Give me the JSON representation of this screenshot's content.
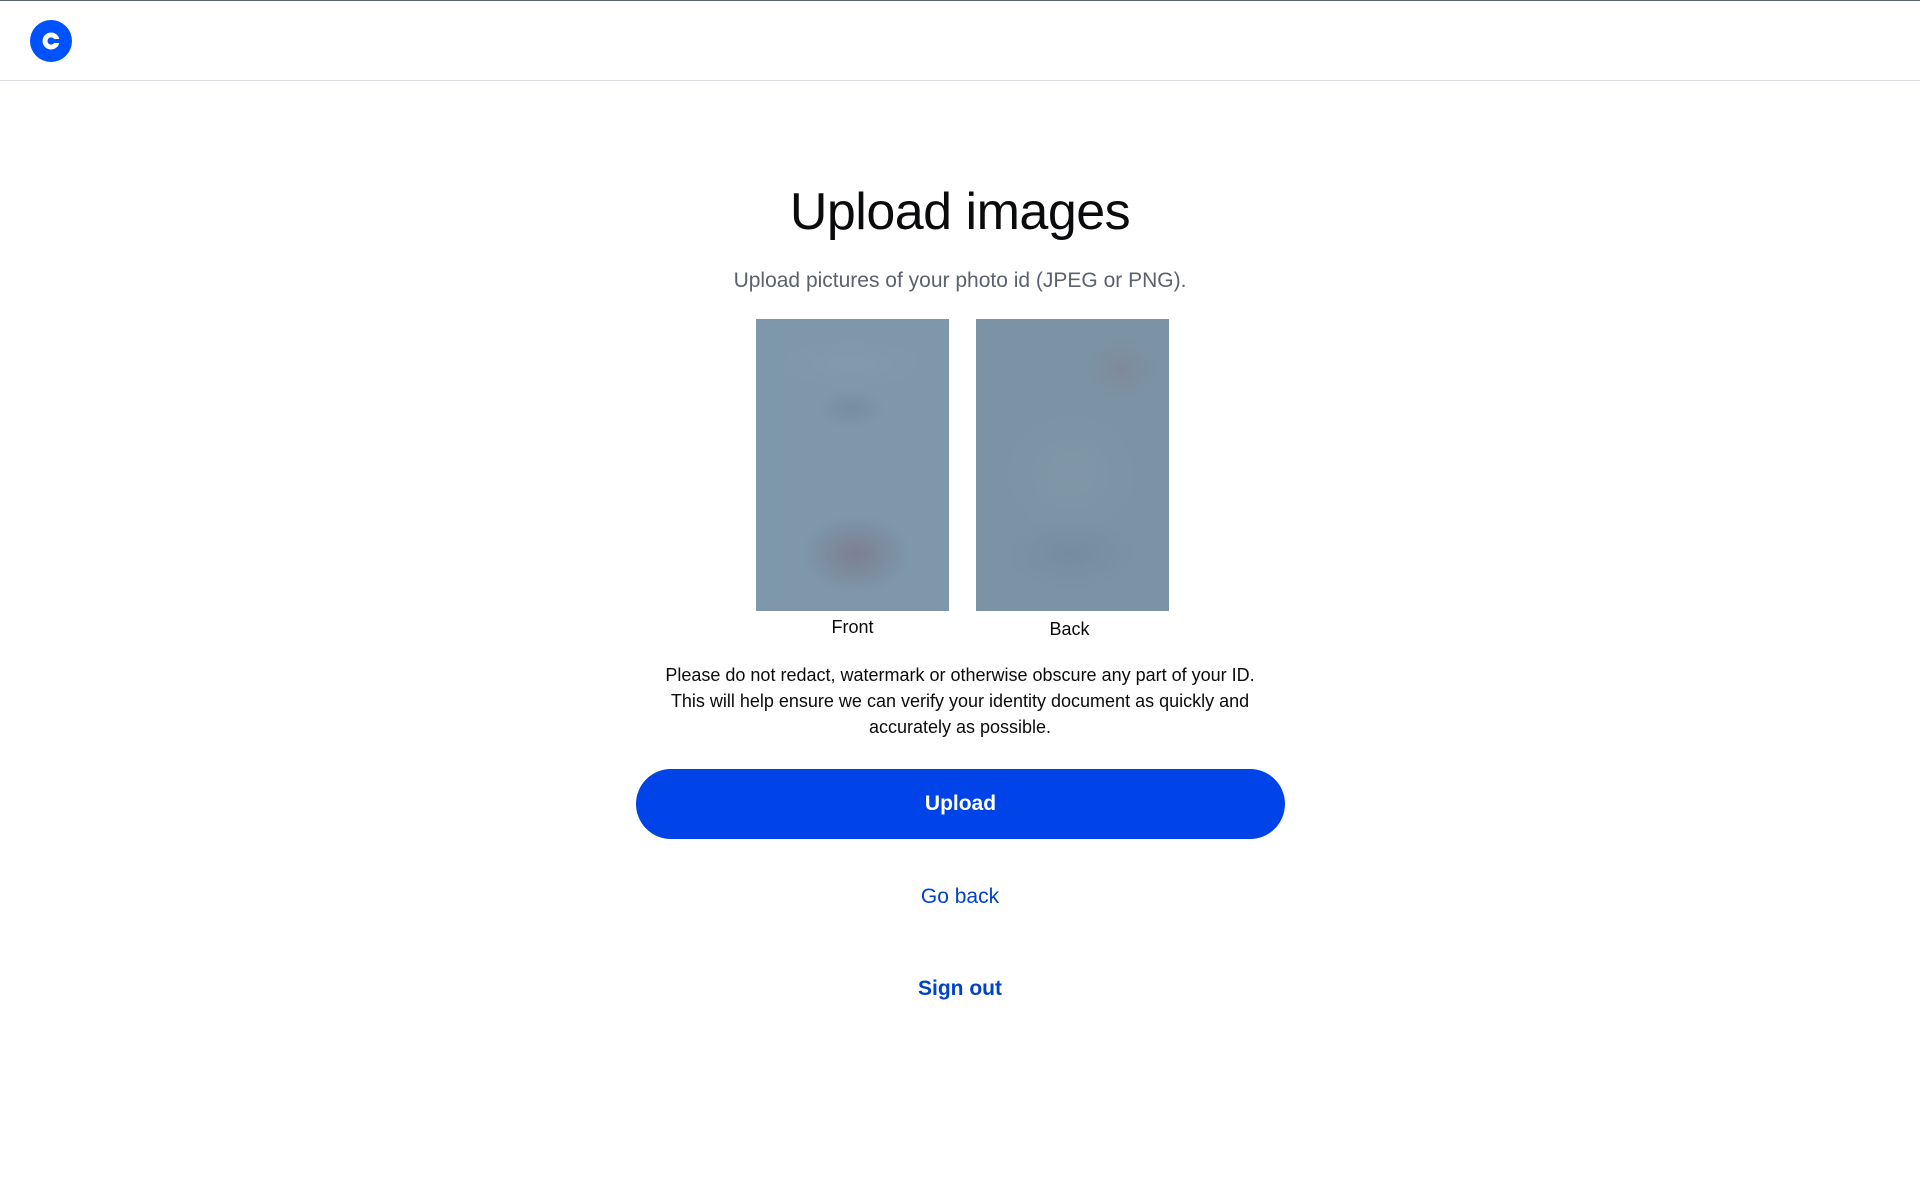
{
  "brand": {
    "logo_icon": "coinbase-c-logo-icon",
    "color": "#0052ff"
  },
  "main": {
    "title": "Upload images",
    "subtitle": "Upload pictures of your photo id (JPEG or PNG).",
    "images": [
      {
        "caption": "Front"
      },
      {
        "caption": "Back"
      }
    ],
    "notice_lines": [
      "Please do not redact, watermark or otherwise obscure any part of your ID.",
      "This will help ensure we can verify your identity document as quickly and",
      "accurately as possible."
    ],
    "upload_label": "Upload",
    "go_back_label": "Go back",
    "sign_out_label": "Sign out"
  },
  "colors": {
    "primary_button": "#0043e9",
    "link": "#0043c8",
    "subtitle_text": "#5b616e"
  }
}
